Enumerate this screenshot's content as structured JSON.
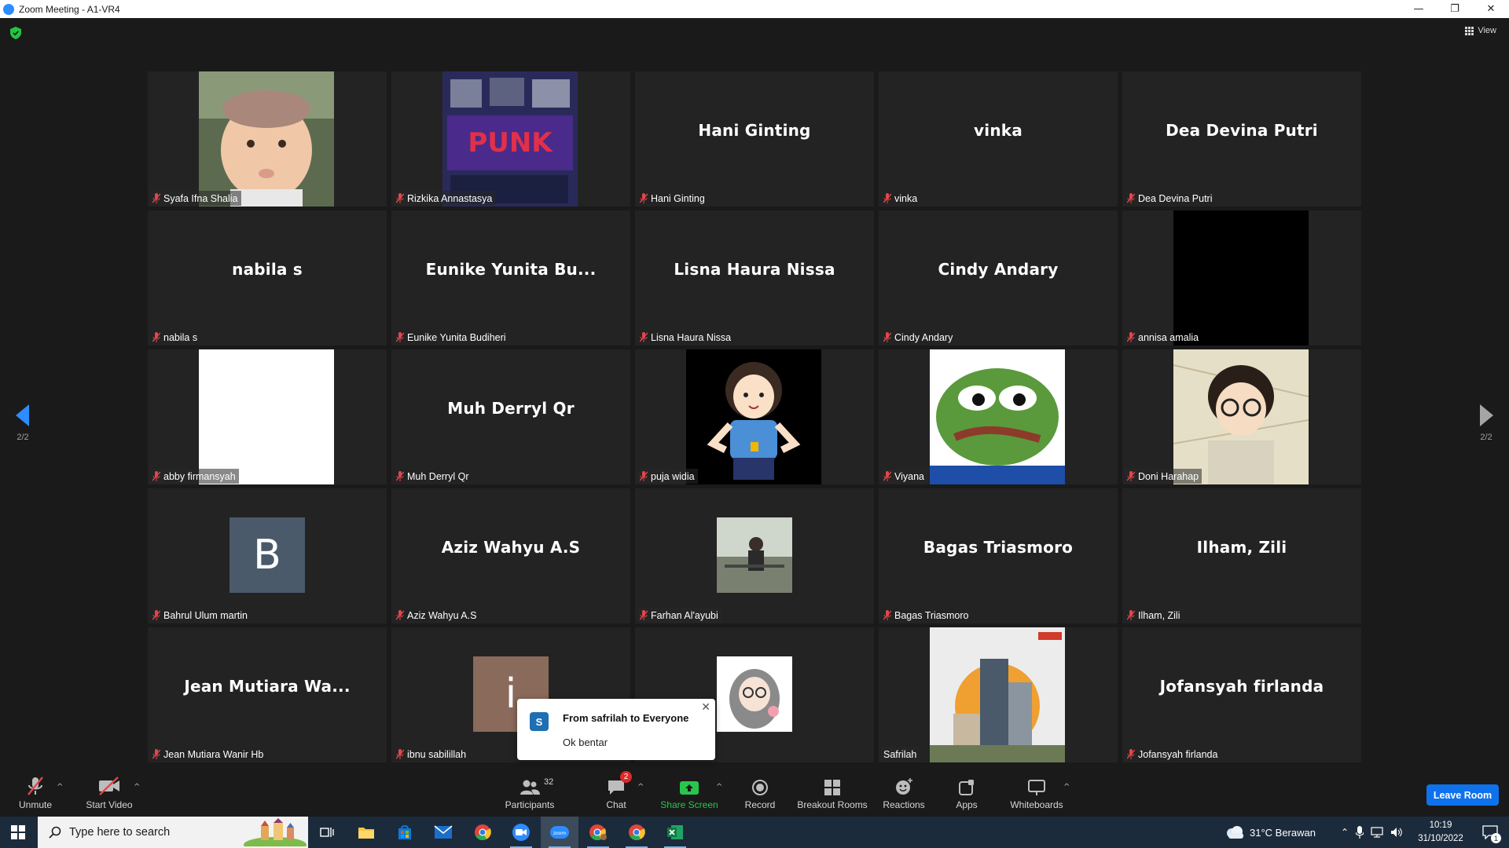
{
  "window": {
    "title": "Zoom Meeting - A1-VR4",
    "minimize": "—",
    "maximize": "❐",
    "close": "✕"
  },
  "header": {
    "view_label": "View"
  },
  "pagination": {
    "left": "2/2",
    "right": "2/2"
  },
  "tiles": [
    {
      "label": "Syafa Ifna Shalia",
      "display": "",
      "kind": "photo-baby"
    },
    {
      "label": "Rizkika Annastasya",
      "display": "",
      "kind": "photo-punk"
    },
    {
      "label": "Hani Ginting",
      "display": "Hani Ginting",
      "kind": "name"
    },
    {
      "label": "vinka",
      "display": "vinka",
      "kind": "name"
    },
    {
      "label": "Dea Devina Putri",
      "display": "Dea Devina Putri",
      "kind": "name"
    },
    {
      "label": "nabila s",
      "display": "nabila s",
      "kind": "name"
    },
    {
      "label": "Eunike Yunita Budiheri",
      "display": "Eunike  Yunita  Bu...",
      "kind": "name"
    },
    {
      "label": "Lisna Haura Nissa",
      "display": "Lisna Haura Nissa",
      "kind": "name"
    },
    {
      "label": "Cindy Andary",
      "display": "Cindy Andary",
      "kind": "name"
    },
    {
      "label": "annisa amalia",
      "display": "",
      "kind": "photo-black"
    },
    {
      "label": "abby firmansyah",
      "display": "",
      "kind": "photo-white"
    },
    {
      "label": "Muh Derryl Qr",
      "display": "Muh Derryl Qr",
      "kind": "name"
    },
    {
      "label": "puja widia",
      "display": "",
      "kind": "photo-girl"
    },
    {
      "label": "Viyana",
      "display": "",
      "kind": "photo-frog"
    },
    {
      "label": "Doni Harahap",
      "display": "",
      "kind": "photo-anime"
    },
    {
      "label": "Bahrul Ulum martin",
      "display": "B",
      "kind": "avatar-b"
    },
    {
      "label": "Aziz Wahyu A.S",
      "display": "Aziz Wahyu A.S",
      "kind": "name"
    },
    {
      "label": "Farhan Al'ayubi",
      "display": "",
      "kind": "photo-farhan"
    },
    {
      "label": "Bagas Triasmoro",
      "display": "Bagas Triasmoro",
      "kind": "name"
    },
    {
      "label": "Ilham, Zili",
      "display": "Ilham, Zili",
      "kind": "name"
    },
    {
      "label": "Jean Mutiara Wanir Hb",
      "display": "Jean Mutiara Wa...",
      "kind": "name"
    },
    {
      "label": "ibnu sabilillah",
      "display": "i",
      "kind": "avatar-i"
    },
    {
      "label": "",
      "display": "",
      "kind": "photo-hijab"
    },
    {
      "label": "Safrilah",
      "display": "",
      "kind": "photo-building"
    },
    {
      "label": "Jofansyah firlanda",
      "display": "Jofansyah firlanda",
      "kind": "name"
    }
  ],
  "chat_toast": {
    "avatar_letter": "S",
    "from": "From safrilah to Everyone",
    "message": "Ok bentar",
    "close": "✕"
  },
  "toolbar": {
    "unmute": "Unmute",
    "start_video": "Start Video",
    "participants": "Participants",
    "participants_count": "32",
    "chat": "Chat",
    "chat_badge": "2",
    "share_screen": "Share Screen",
    "record": "Record",
    "breakout_rooms": "Breakout Rooms",
    "reactions": "Reactions",
    "apps": "Apps",
    "whiteboards": "Whiteboards",
    "leave_room": "Leave Room",
    "caret": "^"
  },
  "taskbar": {
    "search_placeholder": "Type here to search",
    "weather": "31°C  Berawan",
    "time": "10:19",
    "date": "31/10/2022",
    "notification_count": "1"
  },
  "colors": {
    "accent": "#0e72ed",
    "muted_mic": "#e0474c",
    "share_green": "#2ac54d",
    "tile_bg": "#232323"
  }
}
